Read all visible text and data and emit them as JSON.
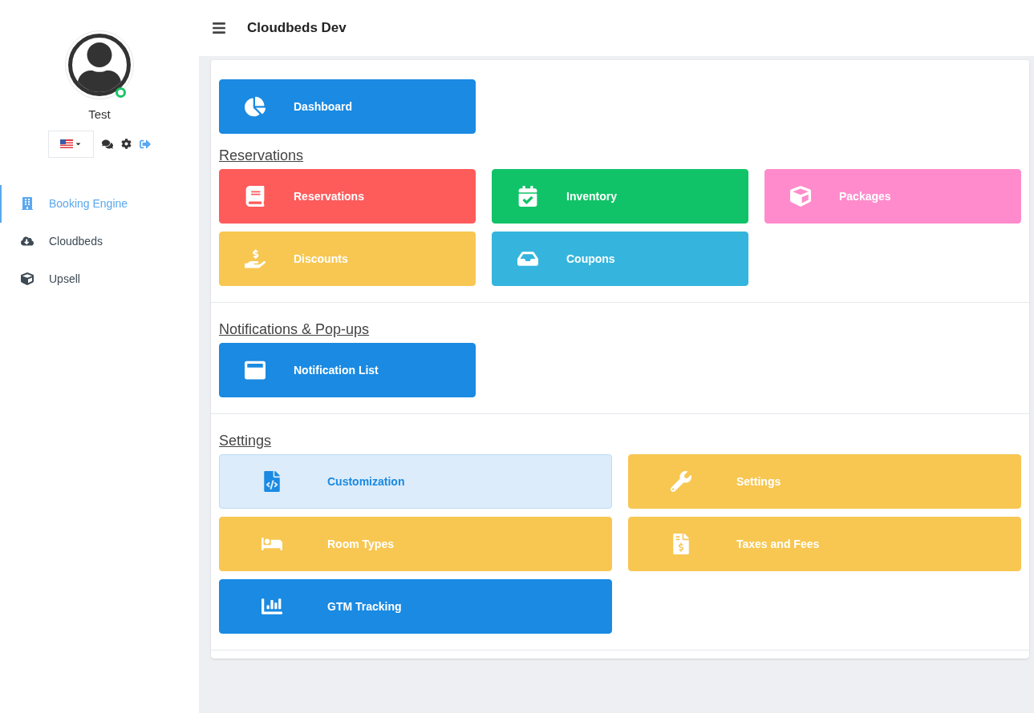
{
  "header": {
    "title": "Cloudbeds Dev"
  },
  "user": {
    "name": "Test",
    "online": true
  },
  "sidebar": {
    "items": [
      {
        "label": "Booking Engine",
        "selected": true
      },
      {
        "label": "Cloudbeds",
        "selected": false
      },
      {
        "label": "Upsell",
        "selected": false
      }
    ]
  },
  "top": {
    "tiles": [
      {
        "label": "Dashboard",
        "color": "#1a8ae2",
        "kind": "solid"
      }
    ]
  },
  "sections": [
    {
      "title": "Reservations",
      "tiles": [
        {
          "label": "Reservations",
          "color": "#fe5b5b",
          "kind": "solid"
        },
        {
          "label": "Inventory",
          "color": "#11c368",
          "kind": "solid"
        },
        {
          "label": "Packages",
          "color": "#ff8bcc",
          "kind": "solid"
        },
        {
          "label": "Discounts",
          "color": "#f7c752",
          "kind": "solid"
        },
        {
          "label": "Coupons",
          "color": "#35b5dd",
          "kind": "solid"
        }
      ]
    },
    {
      "title": "Notifications & Pop-ups",
      "tiles": [
        {
          "label": "Notification List",
          "color": "#1a8ae2",
          "kind": "solid"
        }
      ]
    },
    {
      "title": "Settings",
      "tiles": [
        {
          "label": "Customization",
          "color": "#1a8ae2",
          "kind": "light"
        },
        {
          "label": "Settings",
          "color": "#f7c752",
          "kind": "solid"
        },
        {
          "label": "Room Types",
          "color": "#f7c752",
          "kind": "solid"
        },
        {
          "label": "Taxes and Fees",
          "color": "#f7c752",
          "kind": "solid"
        },
        {
          "label": "GTM Tracking",
          "color": "#1a8ae2",
          "kind": "solid"
        }
      ]
    }
  ]
}
